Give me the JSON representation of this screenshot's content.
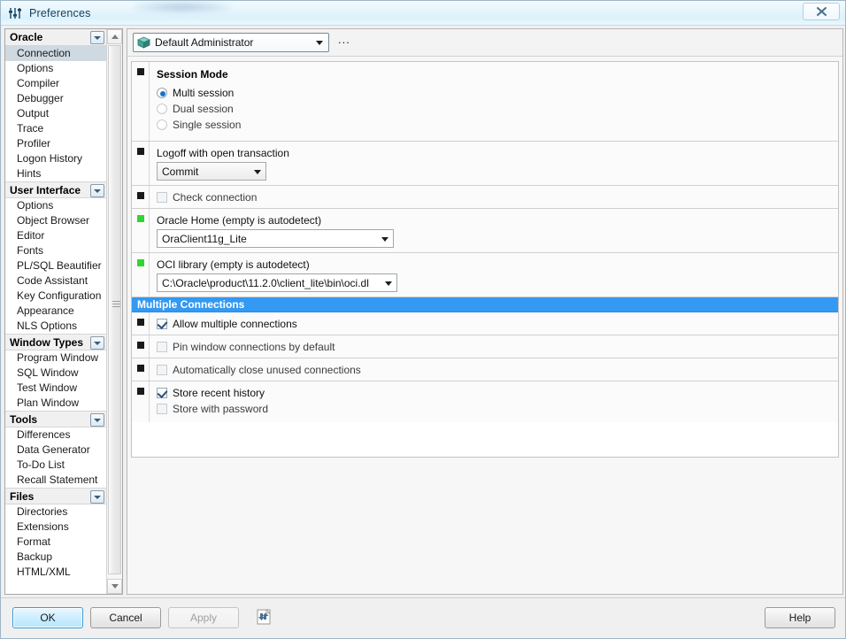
{
  "window": {
    "title": "Preferences",
    "icon": "sliders-icon",
    "close_label": "✖"
  },
  "sidebar": {
    "groups": [
      {
        "label": "Oracle",
        "toggle_icon": "chevron-down-icon",
        "items": [
          {
            "label": "Connection",
            "selected": true
          },
          {
            "label": "Options",
            "selected": false
          },
          {
            "label": "Compiler",
            "selected": false
          },
          {
            "label": "Debugger",
            "selected": false
          },
          {
            "label": "Output",
            "selected": false
          },
          {
            "label": "Trace",
            "selected": false
          },
          {
            "label": "Profiler",
            "selected": false
          },
          {
            "label": "Logon History",
            "selected": false
          },
          {
            "label": "Hints",
            "selected": false
          }
        ]
      },
      {
        "label": "User Interface",
        "toggle_icon": "chevron-down-icon",
        "items": [
          {
            "label": "Options",
            "selected": false
          },
          {
            "label": "Object Browser",
            "selected": false
          },
          {
            "label": "Editor",
            "selected": false
          },
          {
            "label": "Fonts",
            "selected": false
          },
          {
            "label": "PL/SQL Beautifier",
            "selected": false
          },
          {
            "label": "Code Assistant",
            "selected": false
          },
          {
            "label": "Key Configuration",
            "selected": false
          },
          {
            "label": "Appearance",
            "selected": false
          },
          {
            "label": "NLS Options",
            "selected": false
          }
        ]
      },
      {
        "label": "Window Types",
        "toggle_icon": "chevron-down-icon",
        "items": [
          {
            "label": "Program Window",
            "selected": false
          },
          {
            "label": "SQL Window",
            "selected": false
          },
          {
            "label": "Test Window",
            "selected": false
          },
          {
            "label": "Plan Window",
            "selected": false
          }
        ]
      },
      {
        "label": "Tools",
        "toggle_icon": "chevron-down-icon",
        "items": [
          {
            "label": "Differences",
            "selected": false
          },
          {
            "label": "Data Generator",
            "selected": false
          },
          {
            "label": "To-Do List",
            "selected": false
          },
          {
            "label": "Recall Statement",
            "selected": false
          }
        ]
      },
      {
        "label": "Files",
        "toggle_icon": "chevron-down-icon",
        "items": [
          {
            "label": "Directories",
            "selected": false
          },
          {
            "label": "Extensions",
            "selected": false
          },
          {
            "label": "Format",
            "selected": false
          },
          {
            "label": "Backup",
            "selected": false
          },
          {
            "label": "HTML/XML",
            "selected": false
          }
        ]
      }
    ],
    "scrollbar": {
      "up_icon": "triangle-up-icon",
      "down_icon": "triangle-down-icon"
    }
  },
  "profile_bar": {
    "icon": "cube-icon",
    "value": "Default Administrator",
    "dropdown_icon": "chevron-down-icon",
    "more_label": "..."
  },
  "settings": {
    "session_mode": {
      "marker": "black",
      "title": "Session Mode",
      "options": [
        {
          "label": "Multi session",
          "selected": true
        },
        {
          "label": "Dual session",
          "selected": false
        },
        {
          "label": "Single session",
          "selected": false
        }
      ]
    },
    "logoff": {
      "marker": "black",
      "label": "Logoff with open transaction",
      "value": "Commit"
    },
    "check_connection": {
      "marker": "black",
      "label": "Check connection",
      "checked": false
    },
    "oracle_home": {
      "marker": "green",
      "label": "Oracle Home (empty is autodetect)",
      "value": "OraClient11g_Lite"
    },
    "oci_library": {
      "marker": "green",
      "label": "OCI library (empty is autodetect)",
      "value": "C:\\Oracle\\product\\11.2.0\\client_lite\\bin\\oci.dl"
    },
    "multiple_connections": {
      "banner": "Multiple Connections",
      "rows": [
        {
          "marker": "black",
          "label": "Allow multiple connections",
          "checked": true
        },
        {
          "marker": "black",
          "label": "Pin window connections by default",
          "checked": false
        },
        {
          "marker": "black",
          "label": "Automatically close unused connections",
          "checked": false
        }
      ],
      "history_row": {
        "marker": "black",
        "items": [
          {
            "label": "Store recent history",
            "checked": true
          },
          {
            "label": "Store with password",
            "checked": false
          }
        ]
      }
    }
  },
  "footer": {
    "ok": "OK",
    "cancel": "Cancel",
    "apply": "Apply",
    "help": "Help",
    "import_export_icon": "import-export-preferences-icon"
  },
  "colors": {
    "banner_blue": "#3399f3",
    "selection": "#cfd9e2",
    "marker_green": "#31d52f",
    "marker_black": "#1a1a1a",
    "radio_blue": "#1b72c4"
  }
}
